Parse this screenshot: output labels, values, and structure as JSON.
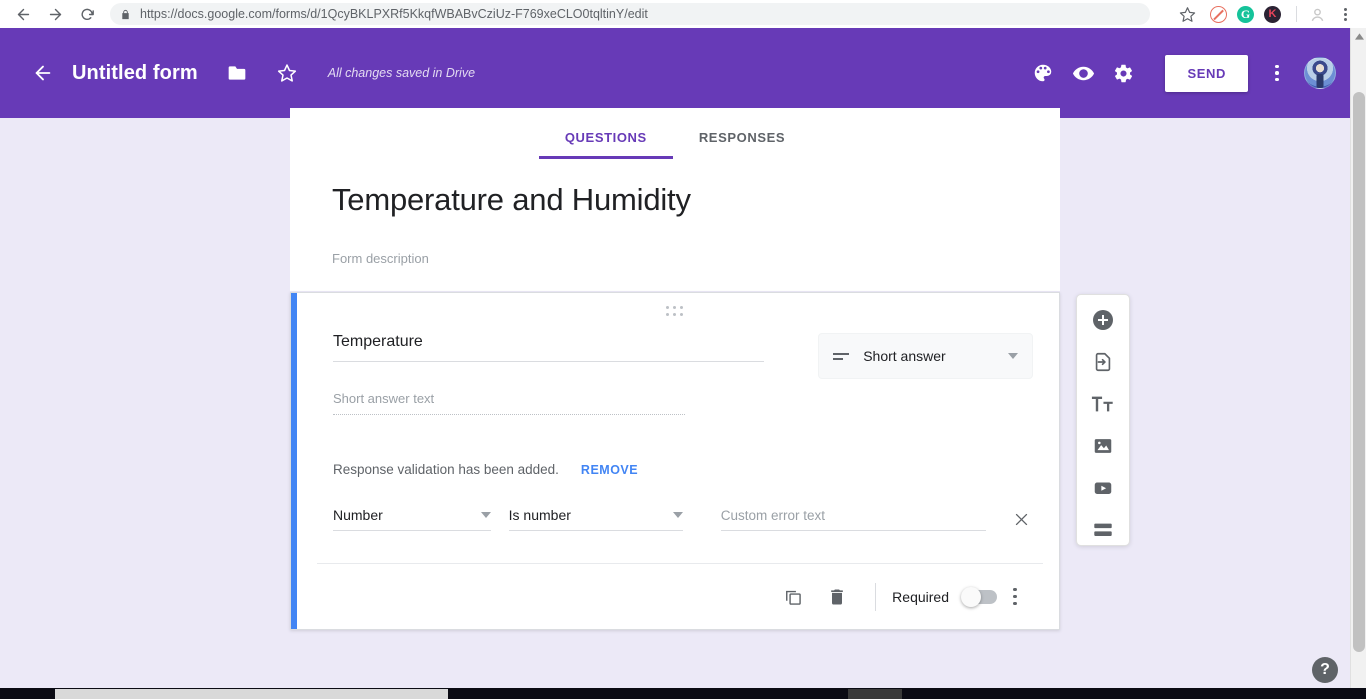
{
  "browser": {
    "url_prefix": "https://",
    "url_domain": "docs.google.com",
    "url_path": "/forms/d/1QcyBKLPXRf5KkqfWBABvCziUz-F769xeCLO0tqltinY/edit",
    "url_full": "https://docs.google.com/forms/d/1QcyBKLPXRf5KkqfWBABvCziUz-F769xeCLO0tqltinY/edit",
    "back_icon": "back-arrow-icon",
    "forward_icon": "forward-arrow-icon",
    "reload_icon": "reload-icon",
    "lock_icon": "lock-icon",
    "bookmark_icon": "star-icon",
    "extensions": [
      {
        "name": "adblock-extension-icon",
        "label": ""
      },
      {
        "name": "grammarly-extension-icon",
        "label": "G"
      },
      {
        "name": "kami-extension-icon",
        "label": "K"
      }
    ],
    "profile_icon": "profile-avatar-icon",
    "menu_icon": "chrome-menu-icon"
  },
  "header": {
    "back_label": "back-arrow-icon",
    "title": "Untitled form",
    "folder_icon": "folder-icon",
    "star_icon": "star-outline-icon",
    "save_status": "All changes saved in Drive",
    "theme_icon": "palette-icon",
    "preview_icon": "eye-preview-icon",
    "settings_icon": "gear-settings-icon",
    "send_label": "SEND",
    "more_icon": "more-vertical-icon",
    "avatar_name": "user-avatar",
    "accent_color": "#673ab7",
    "send_text_color": "#673ab7"
  },
  "tabs": [
    {
      "label": "QUESTIONS",
      "active": true
    },
    {
      "label": "RESPONSES",
      "active": false
    }
  ],
  "form": {
    "title": "Temperature and Humidity",
    "description_placeholder": "Form description"
  },
  "question": {
    "accent_color": "#4285f4",
    "drag_handle": "drag-handle-icon",
    "title": "Temperature",
    "answer_placeholder": "Short answer text",
    "type": {
      "icon": "short-answer-icon",
      "label": "Short answer",
      "caret": "chevron-down-icon"
    },
    "validation": {
      "note": "Response validation has been added.",
      "remove_label": "REMOVE",
      "remove_color": "#4285f4",
      "field_type": "Number",
      "condition": "Is number",
      "error_placeholder": "Custom error text",
      "close_icon": "close-x-icon"
    },
    "footer": {
      "duplicate_icon": "duplicate-icon",
      "delete_icon": "trash-icon",
      "required_label": "Required",
      "required_on": false,
      "more_icon": "more-vertical-icon"
    }
  },
  "side_toolbar": [
    {
      "name": "add-question-button",
      "icon": "plus-circle-icon"
    },
    {
      "name": "import-questions-button",
      "icon": "import-document-icon"
    },
    {
      "name": "add-title-description-button",
      "icon": "title-text-icon"
    },
    {
      "name": "add-image-button",
      "icon": "image-icon"
    },
    {
      "name": "add-video-button",
      "icon": "video-play-icon"
    },
    {
      "name": "add-section-button",
      "icon": "section-divider-icon"
    }
  ],
  "help": {
    "label": "?"
  },
  "scrollbar": {
    "up_icon": "scroll-up-arrow-icon",
    "down_icon": "scroll-down-arrow-icon"
  }
}
